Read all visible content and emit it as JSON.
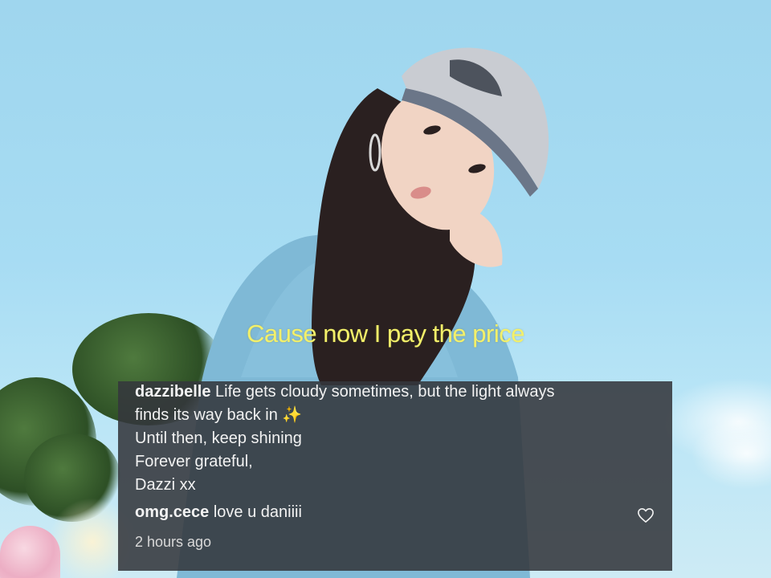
{
  "video": {
    "caption": "Cause now I pay the price"
  },
  "comments": [
    {
      "username": "dazzibelle",
      "lines": [
        "Life gets cloudy sometimes, but the light always",
        "finds its way back in",
        "Until then, keep shining",
        "Forever grateful,",
        "Dazzi xx"
      ],
      "emoji": "✨"
    },
    {
      "username": "omg.cece",
      "text": "love u daniiii",
      "time": "2 hours ago"
    }
  ],
  "icons": {
    "like": "heart-outline-icon"
  },
  "colors": {
    "caption": "#f3f06a",
    "panel": "#34373c",
    "sky": "#a7dcf3"
  }
}
